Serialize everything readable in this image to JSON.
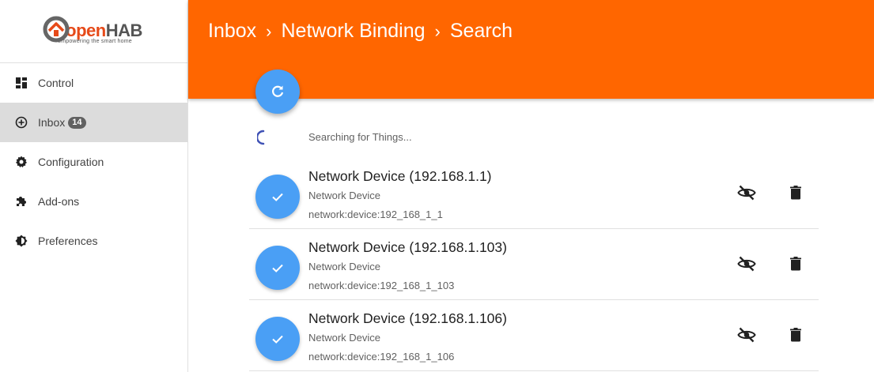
{
  "app": {
    "logo_open": "open",
    "logo_hab": "HAB",
    "logo_tagline": "empowering the smart home"
  },
  "sidebar": {
    "items": [
      {
        "label": "Control",
        "icon": "dashboard-icon"
      },
      {
        "label": "Inbox",
        "icon": "add-circle-icon",
        "badge": "14",
        "active": true
      },
      {
        "label": "Configuration",
        "icon": "gear-icon"
      },
      {
        "label": "Add-ons",
        "icon": "puzzle-icon"
      },
      {
        "label": "Preferences",
        "icon": "brightness-icon"
      }
    ]
  },
  "header": {
    "breadcrumb": [
      "Inbox",
      "Network Binding",
      "Search"
    ],
    "separator": "›",
    "color": "#ff6600"
  },
  "search": {
    "status_text": "Searching for Things..."
  },
  "results": [
    {
      "title": "Network Device (192.168.1.1)",
      "subtitle": "Network Device",
      "uid": "network:device:192_168_1_1"
    },
    {
      "title": "Network Device (192.168.1.103)",
      "subtitle": "Network Device",
      "uid": "network:device:192_168_1_103"
    },
    {
      "title": "Network Device (192.168.1.106)",
      "subtitle": "Network Device",
      "uid": "network:device:192_168_1_106"
    }
  ],
  "colors": {
    "accent": "#4a9ff5",
    "header": "#ff6600",
    "active_nav": "#dcdcdc"
  }
}
